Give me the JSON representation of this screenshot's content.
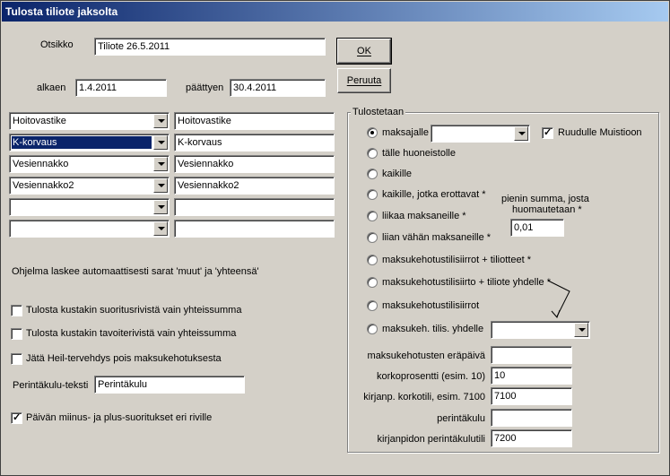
{
  "window": {
    "title": "Tulosta tiliote jaksolta"
  },
  "header": {
    "otsikko_label": "Otsikko",
    "otsikko_value": "Tiliote 26.5.2011",
    "alkaen_label": "alkaen",
    "alkaen_value": "1.4.2011",
    "paattyen_label": "päättyen",
    "paattyen_value": "30.4.2011"
  },
  "buttons": {
    "ok": "OK",
    "cancel": "Peruuta"
  },
  "rows": [
    {
      "combo": "Hoitovastike",
      "text": "Hoitovastike",
      "selected": false
    },
    {
      "combo": "K-korvaus",
      "text": "K-korvaus",
      "selected": true
    },
    {
      "combo": "Vesiennakko",
      "text": "Vesiennakko",
      "selected": false
    },
    {
      "combo": "Vesiennakko2",
      "text": "Vesiennakko2",
      "selected": false
    },
    {
      "combo": "",
      "text": "",
      "selected": false
    },
    {
      "combo": "",
      "text": "",
      "selected": false
    }
  ],
  "info_text": "Ohjelma laskee automaattisesti sarat 'muut' ja 'yhteensä'",
  "options": {
    "suoritus": {
      "label": "Tulosta kustakin suoritusrivistä vain yhteissumma",
      "checked": false
    },
    "tavoite": {
      "label": "Tulosta kustakin tavoiterivistä vain yhteissumma",
      "checked": false
    },
    "heil": {
      "label": "Jätä Heil-tervehdys pois maksukehotuksesta",
      "checked": false
    },
    "perintakulu_label": "Perintäkulu-teksti",
    "perintakulu_value": "Perintäkulu",
    "paivan": {
      "label": "Päivän miinus- ja plus-suoritukset eri riville",
      "checked": true
    }
  },
  "group": {
    "title": "Tulostetaan",
    "radios": [
      {
        "label": "maksajalle",
        "checked": true
      },
      {
        "label": "tälle huoneistolle",
        "checked": false
      },
      {
        "label": "kaikille",
        "checked": false
      },
      {
        "label": "kaikille, jotka erottavat *",
        "checked": false
      },
      {
        "label": "liikaa maksaneille *",
        "checked": false
      },
      {
        "label": "liian vähän maksaneille *",
        "checked": false
      },
      {
        "label": "maksukehotustilisiirrot + tiliotteet *",
        "checked": false
      },
      {
        "label": "maksukehotustilisiirto + tiliote yhdelle *",
        "checked": false
      },
      {
        "label": "maksukehotustilisiirrot",
        "checked": false
      },
      {
        "label": "maksukeh. tilis. yhdelle",
        "checked": false
      }
    ],
    "maksajalle_combo": "",
    "ruudulle": {
      "label": "Ruudulle Muistioon",
      "checked": true
    },
    "pienin_label_1": "pienin summa, josta",
    "pienin_label_2": "huomautetaan *",
    "pienin_value": "0,01",
    "yhdelle_combo": "",
    "fields": [
      {
        "label": "maksukehotusten eräpäivä",
        "value": ""
      },
      {
        "label": "korkoprosentti (esim. 10)",
        "value": "10"
      },
      {
        "label": "kirjanp. korkotili, esim. 7100",
        "value": "7100"
      },
      {
        "label": "perintäkulu",
        "value": ""
      },
      {
        "label": "kirjanpidon perintäkulutili",
        "value": "7200"
      }
    ]
  }
}
